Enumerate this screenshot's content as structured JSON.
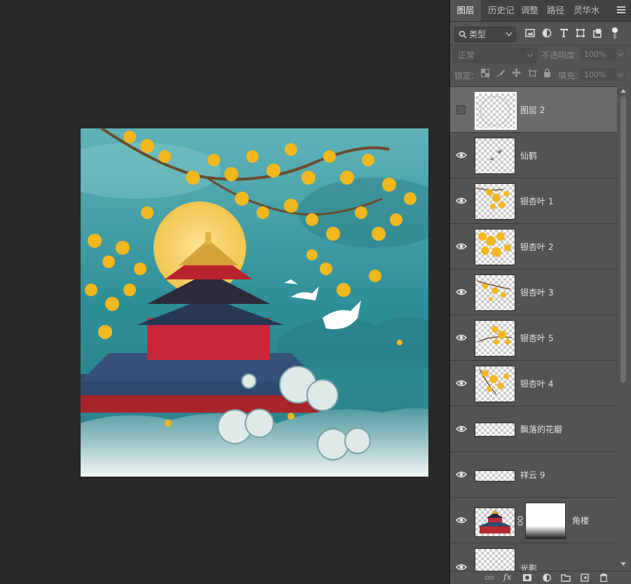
{
  "panel": {
    "tabs": [
      {
        "label": "图层",
        "active": true
      },
      {
        "label": "历史记"
      },
      {
        "label": "调整"
      },
      {
        "label": "路径"
      },
      {
        "label": "灵华水"
      }
    ],
    "filter": {
      "label": "类型"
    },
    "blend_mode": "正常",
    "opacity_label": "不透明度:",
    "opacity_value": "100%",
    "lock_label": "锁定:",
    "fill_label": "填充:",
    "fill_value": "100%",
    "layers": [
      {
        "name": "图层 2",
        "visible": false,
        "selected": true
      },
      {
        "name": "仙鹤",
        "visible": true
      },
      {
        "name": "银杏叶 1",
        "visible": true
      },
      {
        "name": "银杏叶 2",
        "visible": true
      },
      {
        "name": "银杏叶 3",
        "visible": true
      },
      {
        "name": "银杏叶 5",
        "visible": true
      },
      {
        "name": "银杏叶 4",
        "visible": true
      },
      {
        "name": "飘落的花瓣",
        "visible": true
      },
      {
        "name": "祥云 9",
        "visible": true
      },
      {
        "name": "角楼",
        "visible": true,
        "has_mask": true
      },
      {
        "name": "光影",
        "visible": true
      }
    ]
  },
  "colors": {
    "workspace_bg": "#282828",
    "panel_bg": "#535353",
    "selected_layer": "#6b6b6b",
    "sky_teal": "#2e8f98",
    "ginkgo_yellow": "#f2b81e",
    "palace_red": "#b42a2e",
    "moon_yellow": "#f6d56a"
  },
  "icons": {
    "tab_menu": "hamburger-menu-icon",
    "filter": "search-icon",
    "filter_tools": [
      "image-filter-icon",
      "adjustment-filter-icon",
      "type-filter-icon",
      "shape-filter-icon",
      "smart-object-filter-icon",
      "filter-toggle-icon"
    ],
    "lock_tools": [
      "lock-transparent-icon",
      "lock-image-icon",
      "lock-position-icon",
      "lock-artboard-icon",
      "lock-all-icon"
    ],
    "footer": [
      "link-layers-icon",
      "fx-icon",
      "add-mask-icon",
      "new-adjustment-icon",
      "new-group-icon",
      "new-layer-icon",
      "delete-icon"
    ]
  }
}
